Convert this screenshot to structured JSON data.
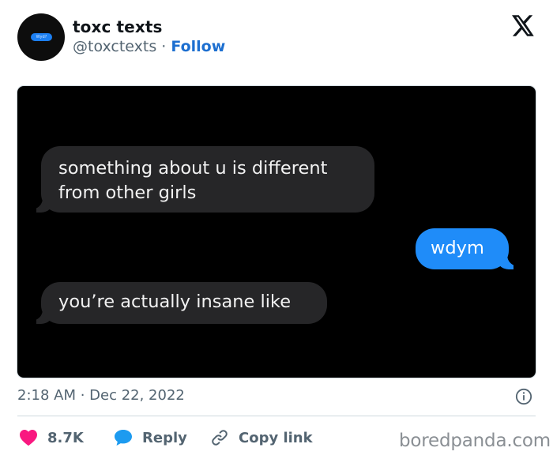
{
  "author": {
    "name": "toxc texts",
    "handle": "@toxctexts",
    "separator": "·",
    "follow_label": "Follow",
    "avatar_text": "Wyd?"
  },
  "conversation": {
    "messages": [
      {
        "side": "incoming",
        "text_lines": [
          "something about u is different",
          "from other girls"
        ]
      },
      {
        "side": "outgoing",
        "text_lines": [
          "wdym"
        ]
      },
      {
        "side": "incoming",
        "text_lines": [
          "you’re actually insane like"
        ]
      }
    ]
  },
  "meta": {
    "timestamp": "2:18 AM · Dec 22, 2022"
  },
  "actions": {
    "likes": "8.7K",
    "reply_label": "Reply",
    "copy_label": "Copy link"
  },
  "watermark": "boredpanda.com",
  "colors": {
    "follow": "#1d6fd0",
    "like_heart": "#f91880",
    "reply_icon": "#1d9bf0",
    "outgoing_bubble": "#1f8cf9",
    "incoming_bubble": "#262628"
  },
  "icons": {
    "brand": "x-logo-icon",
    "like": "heart-icon",
    "reply": "speech-bubble-icon",
    "copy": "link-icon",
    "info": "info-icon"
  }
}
